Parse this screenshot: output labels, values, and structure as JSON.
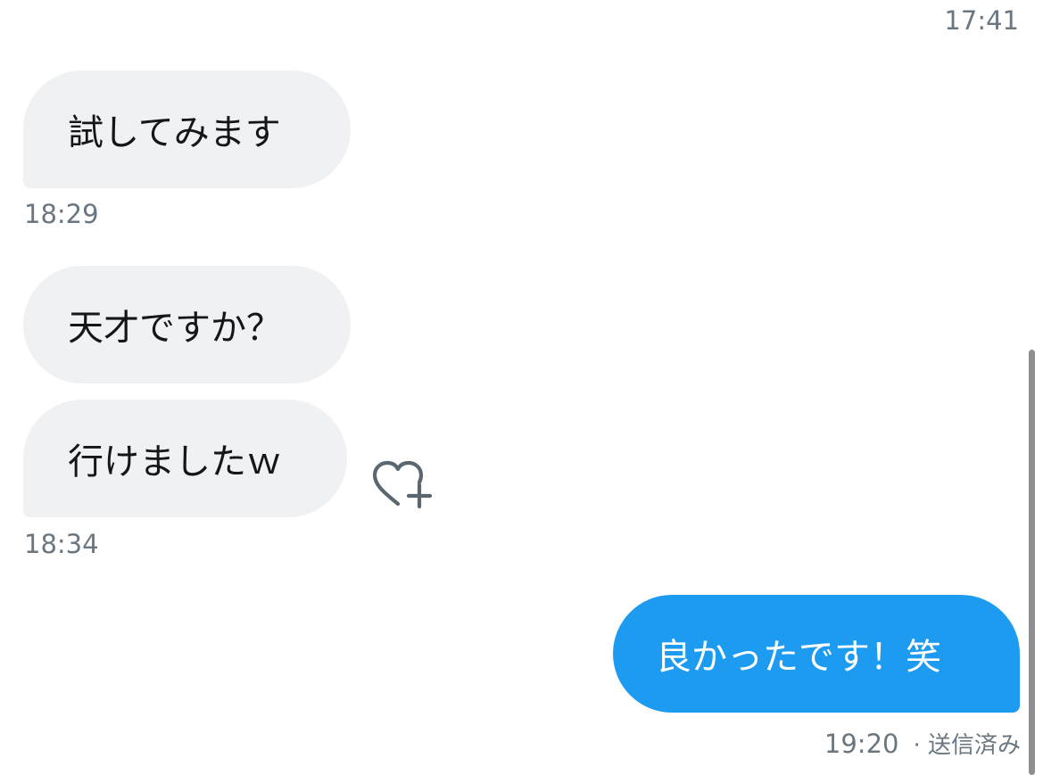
{
  "messages": [
    {
      "direction": "received",
      "text": "",
      "time": "17:41"
    },
    {
      "direction": "received",
      "text": "試してみます",
      "time": "18:29"
    },
    {
      "direction": "received",
      "text": "天才ですか？",
      "time": ""
    },
    {
      "direction": "received",
      "text": "行けましたｗ",
      "time": "18:34"
    },
    {
      "direction": "sent",
      "text": "良かったです！笑",
      "time": "19:20",
      "status": "· 送信済み"
    }
  ],
  "icons": {
    "like": "heart-plus-icon"
  },
  "colors": {
    "received_bubble": "#eff1f3",
    "sent_bubble": "#1d9bf0",
    "timestamp_text": "#6b7780",
    "message_text": "#14171a"
  }
}
